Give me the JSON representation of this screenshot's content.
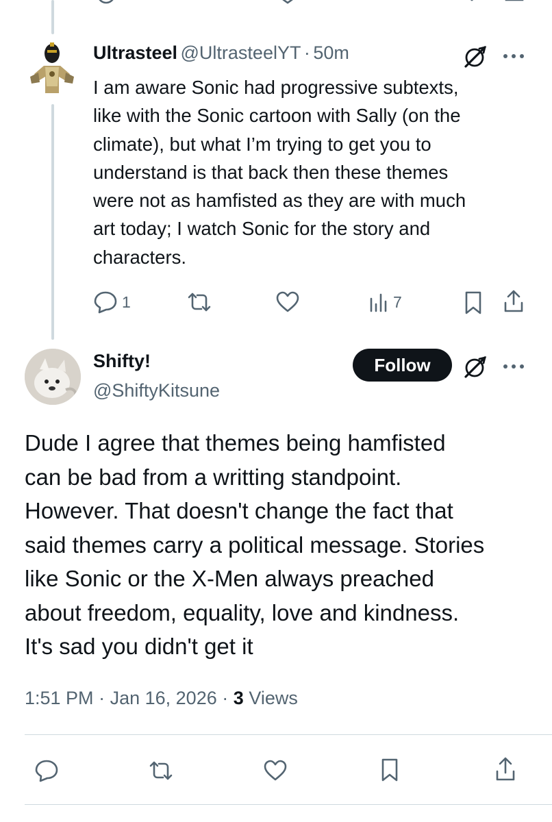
{
  "reply": {
    "name": "Ultrasteel",
    "handle": "@UltrasteelYT",
    "separator": "·",
    "time": "50m",
    "lines": [
      "I am aware Sonic had progressive subtexts,",
      "like with the Sonic cartoon with Sally (on the",
      "climate), but what I’m trying to get you to",
      "understand is that  back then these themes",
      "were not as hamfisted as they are with much",
      "art today; I watch Sonic for the story and",
      "characters."
    ],
    "actions": {
      "replies": "1",
      "retweets": "",
      "likes": "",
      "views": "7"
    },
    "icons": [
      "grok-icon",
      "more-icon",
      "reply-icon",
      "retweet-icon",
      "like-icon",
      "views-icon",
      "bookmark-icon",
      "share-icon"
    ]
  },
  "main": {
    "name": "Shifty!",
    "handle": "@ShiftyKitsune",
    "follow_label": "Follow",
    "lines": [
      "Dude I agree that themes being hamfisted",
      "can be bad from a writting standpoint.",
      "However. That doesn't change the fact that",
      "said themes carry a political message. Stories",
      "like Sonic or the X-Men always preached",
      "about freedom, equality, love and kindness.",
      "It's sad you didn't get it"
    ],
    "meta": {
      "time": "1:51 PM",
      "separator": "·",
      "date": "Jan 16, 2026",
      "views_count": "3",
      "views_label": "Views"
    }
  },
  "colors": {
    "text": "#0f1419",
    "secondary": "#536471",
    "border": "#cfd9de",
    "follow_bg": "#0f1419"
  }
}
